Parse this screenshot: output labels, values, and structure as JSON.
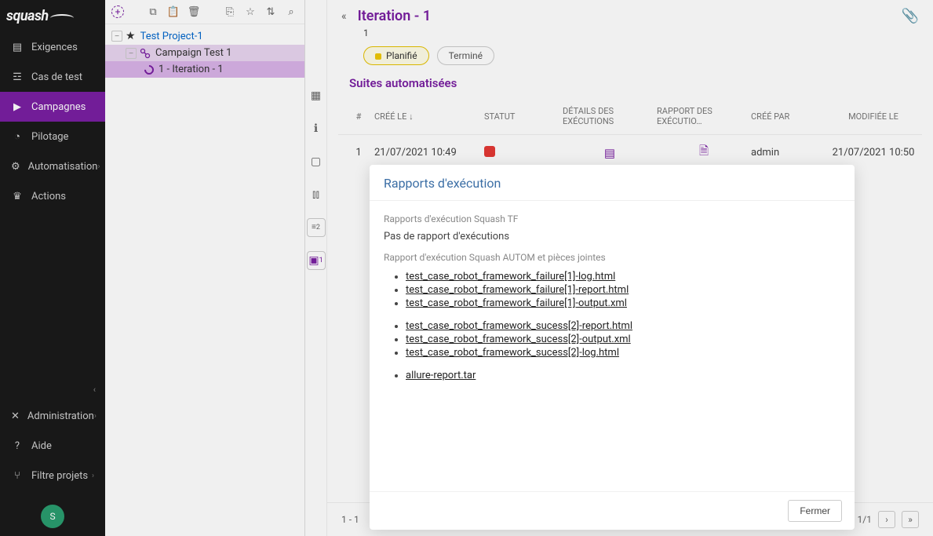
{
  "brand": "squash",
  "sidebar": {
    "items": [
      {
        "icon": "requirements-icon",
        "label": "Exigences"
      },
      {
        "icon": "testcase-icon",
        "label": "Cas de test"
      },
      {
        "icon": "campaigns-icon",
        "label": "Campagnes"
      },
      {
        "icon": "dashboard-icon",
        "label": "Pilotage"
      },
      {
        "icon": "automation-icon",
        "label": "Automatisation",
        "chevron": true
      },
      {
        "icon": "actions-icon",
        "label": "Actions"
      }
    ],
    "bottom": [
      {
        "icon": "admin-icon",
        "label": "Administration",
        "chevron": true
      },
      {
        "icon": "help-icon",
        "label": "Aide"
      },
      {
        "icon": "filter-icon",
        "label": "Filtre projets",
        "chevron": true
      }
    ],
    "user_initial": "S"
  },
  "tree": {
    "root": {
      "label": "Test Project-1"
    },
    "campaign": {
      "label": "Campaign Test 1"
    },
    "iteration": {
      "label": "1 - Iteration - 1"
    }
  },
  "iconstrip": {
    "list_count": "2",
    "robot_count": "1"
  },
  "main": {
    "title": "Iteration - 1",
    "breadcrumb": "1",
    "chips": {
      "planned": "Planifié",
      "done": "Terminé"
    },
    "section": "Suites automatisées",
    "columns": {
      "num": "#",
      "created": "CRÉÉ LE",
      "status": "STATUT",
      "details": "DÉTAILS DES EXÉCUTIONS",
      "report": "RAPPORT DES EXÉCUTIO…",
      "created_by": "CRÉÉ PAR",
      "modified": "MODIFIÉE LE"
    },
    "row": {
      "num": "1",
      "created": "21/07/2021 10:49",
      "created_by": "admin",
      "modified": "21/07/2021 10:50"
    },
    "footer_range": "1 - 1",
    "footer_page": "1/1"
  },
  "modal": {
    "title": "Rapports d'exécution",
    "section_tf": "Rapports d'exécution Squash TF",
    "no_report": "Pas de rapport d'exécutions",
    "section_autom": "Rapport d'exécution Squash AUTOM et pièces jointes",
    "group1": [
      "test_case_robot_framework_failure[1]-log.html",
      "test_case_robot_framework_failure[1]-report.html",
      "test_case_robot_framework_failure[1]-output.xml"
    ],
    "group2": [
      "test_case_robot_framework_sucess[2]-report.html",
      "test_case_robot_framework_sucess[2]-output.xml",
      "test_case_robot_framework_sucess[2]-log.html"
    ],
    "group3": [
      "allure-report.tar"
    ],
    "close": "Fermer"
  }
}
